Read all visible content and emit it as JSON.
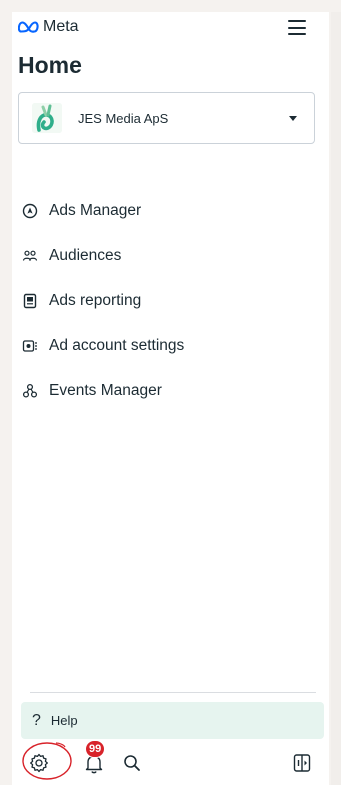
{
  "brand": {
    "name": "Meta",
    "logo_icon": "meta-infinity-icon",
    "color": "#0866ff"
  },
  "header": {
    "menu_icon": "hamburger-menu-icon"
  },
  "page": {
    "title": "Home"
  },
  "account": {
    "name": "JES Media ApS",
    "avatar_icon": "account-logo",
    "dropdown_icon": "caret-down-icon"
  },
  "nav": {
    "items": [
      {
        "label": "Ads Manager",
        "icon": "ads-manager-icon"
      },
      {
        "label": "Audiences",
        "icon": "audiences-icon"
      },
      {
        "label": "Ads reporting",
        "icon": "ads-reporting-icon"
      },
      {
        "label": "Ad account settings",
        "icon": "ad-account-settings-icon"
      },
      {
        "label": "Events Manager",
        "icon": "events-manager-icon"
      }
    ]
  },
  "help": {
    "label": "Help",
    "icon": "question-icon",
    "background": "#e6f4ef"
  },
  "bottom_bar": {
    "settings_icon": "gear-icon",
    "notifications": {
      "icon": "bell-icon",
      "badge": "99",
      "badge_color": "#d8232a"
    },
    "search_icon": "search-icon",
    "panel_icon": "panel-toggle-icon",
    "annotation_color": "#d8232a"
  }
}
